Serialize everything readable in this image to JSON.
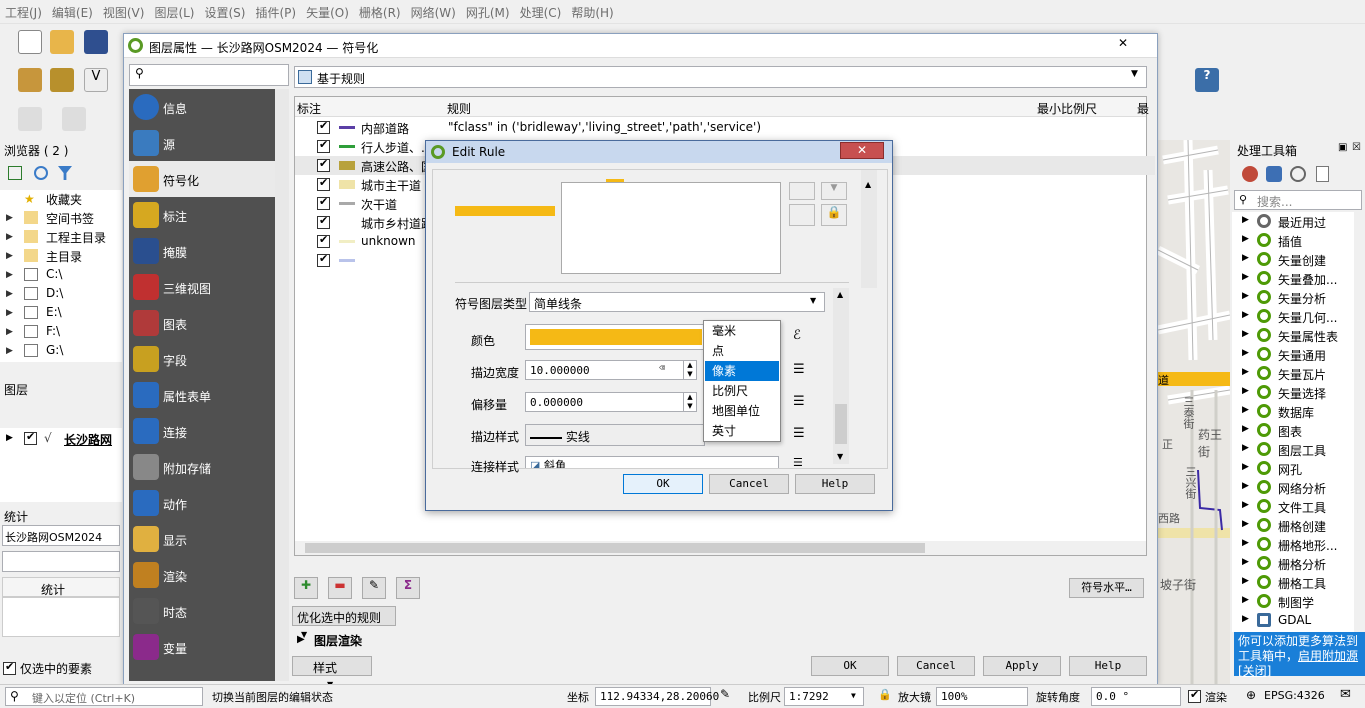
{
  "menu": [
    "工程(J)",
    "编辑(E)",
    "视图(V)",
    "图层(L)",
    "设置(S)",
    "插件(P)",
    "矢量(O)",
    "栅格(R)",
    "网络(W)",
    "网孔(M)",
    "处理(C)",
    "帮助(H)"
  ],
  "browser": {
    "title": "浏览器 ( 2 )",
    "items": [
      "收藏夹",
      "空间书签",
      "工程主目录",
      "主目录",
      "C:\\",
      "D:\\",
      "E:\\",
      "F:\\",
      "G:\\"
    ]
  },
  "layers": {
    "title": "图层",
    "layer_name": "长沙路网"
  },
  "stats": {
    "title": "统计",
    "layer": "长沙路网OSM2024",
    "col": "统计",
    "only_selected": "仅选中的要素"
  },
  "dialog": {
    "title": "图层属性 — 长沙路网OSM2024 — 符号化",
    "renderer": "基于规则",
    "sidebar": [
      "信息",
      "源",
      "符号化",
      "标注",
      "掩膜",
      "三维视图",
      "图表",
      "字段",
      "属性表单",
      "连接",
      "附加存储",
      "动作",
      "显示",
      "渲染",
      "时态",
      "变量"
    ],
    "col_label": "标注",
    "col_rule": "规则",
    "col_minscale": "最小比例尺",
    "col_max": "最",
    "rules": [
      {
        "label": "内部道路",
        "expr": "\"fclass\" in ('bridleway','living_street','path','service')",
        "color": "#5b3fa6"
      },
      {
        "label": "行人步道、...",
        "expr": "",
        "color": "#2e9e3a"
      },
      {
        "label": "高速公路、国",
        "expr": "",
        "color": "#b8a23c"
      },
      {
        "label": "城市主干道",
        "expr": "",
        "color": "#efe3a8"
      },
      {
        "label": "次干道",
        "expr": "",
        "color": "#a9a9a9"
      },
      {
        "label": "城市乡村道路",
        "expr": "",
        "color": "#ffffff"
      },
      {
        "label": "unknown",
        "expr": "",
        "color": "#f1eec4"
      },
      {
        "label": "",
        "expr": "",
        "color": "#b9c3ea"
      }
    ],
    "refine": "优化选中的规则",
    "layer_render": "图层渲染",
    "style": "样式",
    "symbol_levels": "符号水平…",
    "ok": "OK",
    "cancel": "Cancel",
    "apply": "Apply",
    "help": "Help"
  },
  "edit_rule": {
    "title": "Edit Rule",
    "symbol_layer_type_label": "符号图层类型",
    "symbol_layer_type": "简单线条",
    "color_label": "颜色",
    "stroke_width_label": "描边宽度",
    "stroke_width": "10.000000",
    "offset_label": "偏移量",
    "offset": "0.000000",
    "stroke_style_label": "描边样式",
    "stroke_style": "实线",
    "join_style_label": "连接样式",
    "join_style": "斜角",
    "unit_options": [
      "毫米",
      "点",
      "像素",
      "比例尺",
      "地图单位",
      "英寸"
    ],
    "unit_selected": "像素",
    "ok": "OK",
    "cancel": "Cancel",
    "help": "Help",
    "accent_color": "#f5b915"
  },
  "toolbox": {
    "title": "处理工具箱",
    "search_placeholder": "搜索...",
    "items": [
      "最近用过",
      "插值",
      "矢量创建",
      "矢量叠加...",
      "矢量分析",
      "矢量几何...",
      "矢量属性表",
      "矢量通用",
      "矢量瓦片",
      "矢量选择",
      "数据库",
      "图表",
      "图层工具",
      "网孔",
      "网络分析",
      "文件工具",
      "栅格创建",
      "栅格地形...",
      "栅格分析",
      "栅格工具",
      "制图学",
      "GDAL"
    ],
    "notice_text": "你可以添加更多算法到工具箱中，",
    "notice_link": "启用附加源",
    "notice_close": "[关闭]"
  },
  "map_labels": [
    "三泰街",
    "药王街",
    "三兴街",
    "西路",
    "坡子街",
    "道",
    "正"
  ],
  "statusbar": {
    "locate_placeholder": "键入以定位 (Ctrl+K)",
    "message": "切换当前图层的编辑状态",
    "coord_label": "坐标",
    "coord": "112.94334,28.20060",
    "scale_label": "比例尺",
    "scale": "1:7292",
    "magnifier_label": "放大镜",
    "magnifier": "100%",
    "rotation_label": "旋转角度",
    "rotation": "0.0 °",
    "render_label": "渲染",
    "crs": "EPSG:4326"
  }
}
